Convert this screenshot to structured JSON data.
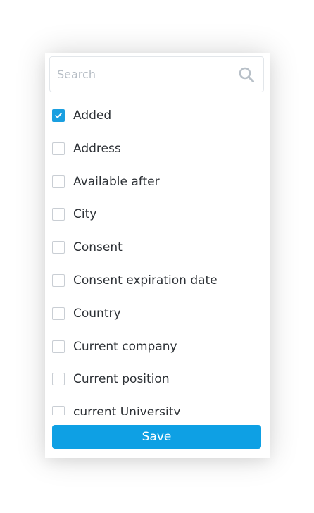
{
  "search": {
    "placeholder": "Search",
    "value": ""
  },
  "columns": {
    "items": [
      {
        "label": "Added",
        "checked": true
      },
      {
        "label": "Address",
        "checked": false
      },
      {
        "label": "Available after",
        "checked": false
      },
      {
        "label": "City",
        "checked": false
      },
      {
        "label": "Consent",
        "checked": false
      },
      {
        "label": "Consent expiration date",
        "checked": false
      },
      {
        "label": "Country",
        "checked": false
      },
      {
        "label": "Current company",
        "checked": false
      },
      {
        "label": "Current position",
        "checked": false
      },
      {
        "label": "current University",
        "checked": false
      }
    ]
  },
  "footer": {
    "save_label": "Save"
  },
  "colors": {
    "accent": "#0ea0e4",
    "checkbox_checked": "#1a9fe0",
    "text": "#2d3136",
    "placeholder": "#b5bcc4"
  }
}
